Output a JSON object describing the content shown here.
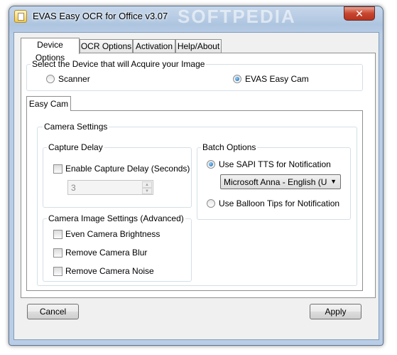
{
  "window": {
    "title": "EVAS Easy OCR for Office v3.07",
    "watermark": "SOFTPEDIA",
    "close_glyph": "✕"
  },
  "tabs": [
    {
      "label": "Device Options",
      "active": true
    },
    {
      "label": "OCR Options",
      "active": false
    },
    {
      "label": "Activation",
      "active": false
    },
    {
      "label": "Help/About",
      "active": false
    }
  ],
  "device_group": {
    "title": "Select the Device that will Acquire your Image",
    "scanner_label": "Scanner",
    "scanner_selected": false,
    "cam_label": "EVAS Easy Cam",
    "cam_selected": true
  },
  "easy_cam": {
    "tab_label": "Easy Cam",
    "camera_settings_title": "Camera Settings",
    "capture_delay": {
      "title": "Capture Delay",
      "enable_label": "Enable Capture Delay (Seconds)",
      "enabled": false,
      "value": "3"
    },
    "image_settings": {
      "title": "Camera Image Settings (Advanced)",
      "items": [
        {
          "label": "Even Camera Brightness",
          "checked": false
        },
        {
          "label": "Remove Camera Blur",
          "checked": false
        },
        {
          "label": "Remove Camera Noise",
          "checked": false
        }
      ]
    },
    "batch_options": {
      "title": "Batch Options",
      "sapi_label": "Use SAPI TTS for Notification",
      "sapi_selected": true,
      "voice_selected": "Microsoft Anna - English (United States)",
      "balloon_label": "Use Balloon Tips for Notification",
      "balloon_selected": false
    }
  },
  "footer": {
    "cancel_label": "Cancel",
    "apply_label": "Apply"
  },
  "icons": {
    "spin_up": "up-arrow-icon",
    "spin_down": "down-arrow-icon",
    "dropdown": "chevron-down-icon"
  }
}
